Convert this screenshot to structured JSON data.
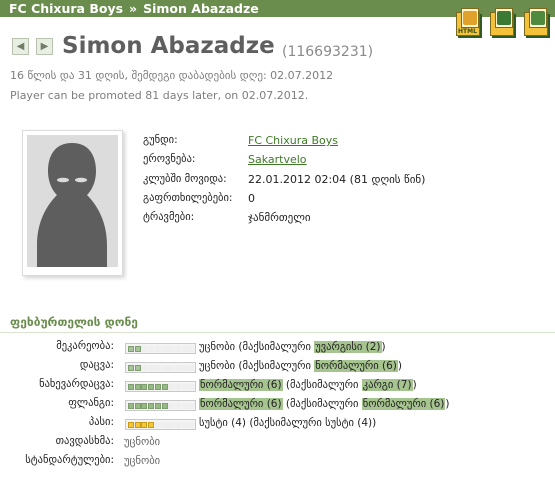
{
  "breadcrumb": {
    "club": "FC Chixura Boys",
    "separator": "»",
    "player": "Simon Abazadze"
  },
  "export": {
    "icons": [
      "html-export-icon",
      "print-icon",
      "export-icon"
    ],
    "labels": [
      "HTML",
      "",
      ""
    ]
  },
  "player": {
    "name": "Simon Abazadze",
    "id": "(116693231)",
    "age_line": "16 წლის და 31 დღის, შემდეგი დაბადების დღე: 02.07.2012",
    "promotion_line": "Player can be promoted 81 days later, on 02.07.2012."
  },
  "details": [
    {
      "key": "გუნდი:",
      "value": "FC Chixura Boys",
      "link": true
    },
    {
      "key": "ეროვნება:",
      "value": "Sakartvelo",
      "link": true
    },
    {
      "key": "კლუბში მოვიდა:",
      "value": "22.01.2012 02:04 (81 დღის წინ)",
      "link": false
    },
    {
      "key": "გაფრთხილებები:",
      "value": "0",
      "link": false
    },
    {
      "key": "ტრავმები:",
      "value": "ჯანმრთელი",
      "link": false
    }
  ],
  "skills_section_title": "ფეხბურთელის დონე",
  "skills": [
    {
      "key": "მეკარეობა:",
      "level": 2,
      "color": "#a9c49c",
      "pre": "უცნობი (მაქსიმალური ",
      "hl1": "",
      "mid": "",
      "hl2": "უვარგისი (2)",
      "post": ")"
    },
    {
      "key": "დაცვა:",
      "level": 2,
      "color": "#a9c49c",
      "pre": "უცნობი (მაქსიმალური ",
      "hl1": "",
      "mid": "",
      "hl2": "ნორმალური (6)",
      "post": ")"
    },
    {
      "key": "ნახევარდაცვა:",
      "level": 6,
      "color": "#97b984",
      "pre": "",
      "hl1": "ნორმალური (6)",
      "mid": " (მაქსიმალური ",
      "hl2": "კარგი (7)",
      "post": ")"
    },
    {
      "key": "ფლანგი:",
      "level": 6,
      "color": "#97b984",
      "pre": "",
      "hl1": "ნორმალური (6)",
      "mid": " (მაქსიმალური ",
      "hl2": "ნორმალური (6)",
      "post": ")"
    },
    {
      "key": "პასი:",
      "level": 4,
      "color": "#f4c73b",
      "pre": "",
      "hl1": "სუსტი (4)",
      "mid": " (მაქსიმალური ",
      "hl2": "სუსტი (4)",
      "post": ")",
      "hl_plain": true
    }
  ],
  "extra_skills": [
    {
      "key": "თავდასხმა:",
      "value": "უცნობი"
    },
    {
      "key": "სტანდარტულები:",
      "value": "უცნობი"
    }
  ]
}
